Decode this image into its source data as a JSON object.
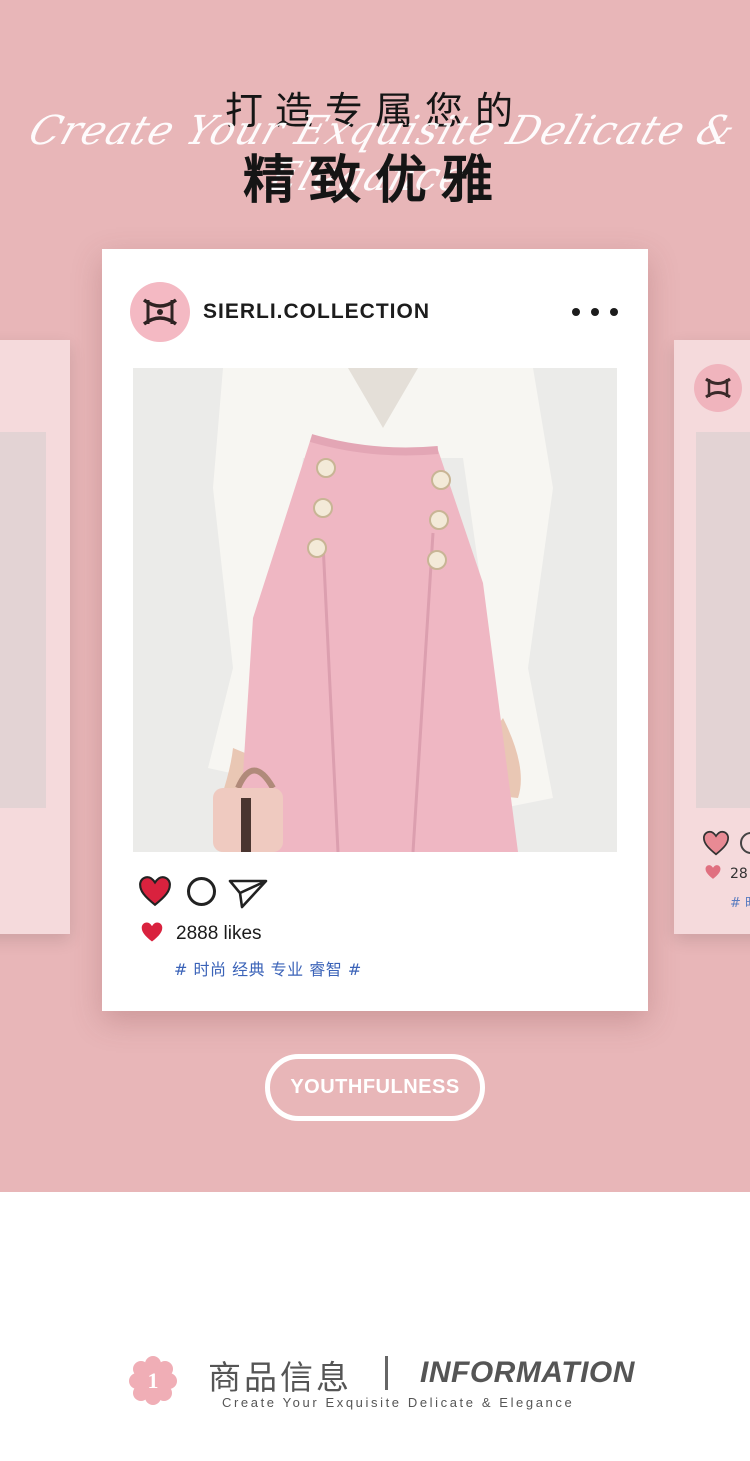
{
  "header": {
    "script_text": "Create Your Exquisite Delicate & Elegance",
    "title_line1": "打造专属您的",
    "title_line2": "精致优雅"
  },
  "post": {
    "username": "SIERLI.COLLECTION",
    "likes_text": "2888 likes",
    "hashtags": "# 时尚 经典 专业 睿智 #",
    "icons": [
      "heart-icon",
      "comment-icon",
      "send-icon",
      "more-icon"
    ]
  },
  "side_post": {
    "likes_text": "28",
    "hashtags": "# 时"
  },
  "badge": {
    "label": "YOUTHFULNESS"
  },
  "info": {
    "number": "1",
    "title_cn": "商品信息",
    "title_en": "INFORMATION",
    "subtitle": "Create Your Exquisite Delicate & Elegance"
  },
  "colors": {
    "background_pink": "#e8b6b8",
    "heart_red": "#d9223e",
    "hashtag_blue": "#3b63b8",
    "logo_pink": "#f4b9c3"
  }
}
